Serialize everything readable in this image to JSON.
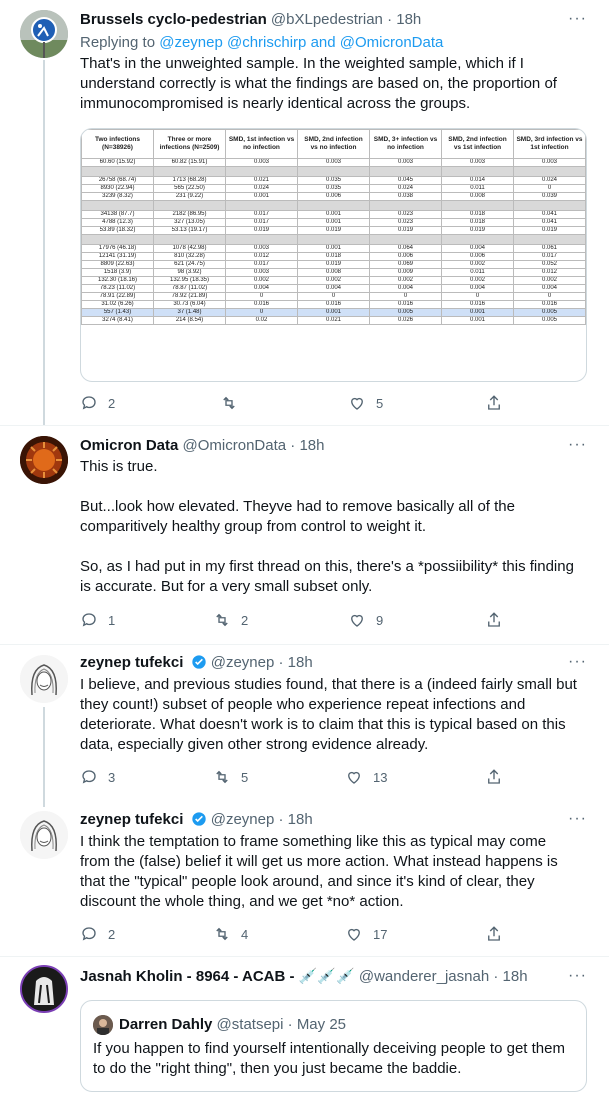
{
  "tweets": [
    {
      "name": "Brussels cyclo-pedestrian",
      "handle": "@bXLpedestrian",
      "time": "18h",
      "replying_prefix": "Replying to",
      "replying_handles": "@zeynep @chrischirp",
      "replying_and": "and",
      "replying_last": "@OmicronData",
      "text": [
        "That's in the unweighted sample. In the weighted sample, which if I understand correctly is what the findings are based on, the proportion of immunocompromised is nearly identical across the groups."
      ],
      "replies": "2",
      "retweets": "",
      "likes": "5"
    },
    {
      "name": "Omicron Data",
      "handle": "@OmicronData",
      "time": "18h",
      "text": [
        "This is true.",
        "But...look how elevated. Theyve had to remove basically all of the comparitively healthy group from control to weight it.",
        "So, as I had put in my first thread on this, there's a *possiibility* this finding is accurate. But for a very small subset only."
      ],
      "replies": "1",
      "retweets": "2",
      "likes": "9"
    },
    {
      "name": "zeynep tufekci",
      "handle": "@zeynep",
      "time": "18h",
      "text": [
        "I believe, and previous studies found, that there is a (indeed fairly small but they count!) subset of people who experience repeat infections and deteriorate. What doesn't work is to claim that this is typical based on this data, especially given other strong evidence already."
      ],
      "replies": "3",
      "retweets": "5",
      "likes": "13"
    },
    {
      "name": "zeynep tufekci",
      "handle": "@zeynep",
      "time": "18h",
      "text": [
        "I think the temptation to frame something like this as  typical may come from the (false) belief it will get us more action. What instead happens is that the \"typical\" people look around, and since it's kind of clear, they discount the whole thing, and we get *no* action."
      ],
      "replies": "2",
      "retweets": "4",
      "likes": "17"
    },
    {
      "name": "Jasnah Kholin - 8964 - ACAB - 💉💉💉",
      "handle": "@wanderer_jasnah",
      "time": "18h"
    }
  ],
  "quote": {
    "name": "Darren Dahly",
    "handle": "@statsepi",
    "time": "May 25",
    "text": "If you happen to find yourself intentionally deceiving people to get them to do the \"right thing\", then you just became the baddie."
  },
  "dot": "·",
  "more": "···",
  "table": {
    "headers": [
      "Two infections (N=38926)",
      "Three or more infections (N=2509)",
      "SMD, 1st infection vs no infection",
      "SMD, 2nd infection vs no infection",
      "SMD, 3+ infection vs no infection",
      "SMD, 2nd infection vs 1st infection",
      "SMD, 3rd infection vs 1st infection"
    ],
    "rows": [
      {
        "cls": "",
        "cells": [
          "60.60 (15.92)",
          "60.82 (15.91)",
          "0.003",
          "0.003",
          "0.003",
          "0.003",
          "0.003"
        ]
      },
      {
        "cls": "gray",
        "cells": [
          "",
          "",
          "",
          "",
          "",
          "",
          ""
        ]
      },
      {
        "cls": "",
        "cells": [
          "26758 (68.74)",
          "1713 (68.28)",
          "0.021",
          "0.035",
          "0.045",
          "0.014",
          "0.024"
        ]
      },
      {
        "cls": "",
        "cells": [
          "8930 (22.94)",
          "565 (22.50)",
          "0.024",
          "0.035",
          "0.024",
          "0.011",
          "0"
        ]
      },
      {
        "cls": "",
        "cells": [
          "3239 (8.32)",
          "231 (9.22)",
          "0.001",
          "0.006",
          "0.038",
          "0.008",
          "0.039"
        ]
      },
      {
        "cls": "gray",
        "cells": [
          "",
          "",
          "",
          "",
          "",
          "",
          ""
        ]
      },
      {
        "cls": "",
        "cells": [
          "34138 (87.7)",
          "2182 (86.95)",
          "0.017",
          "0.001",
          "0.023",
          "0.018",
          "0.041"
        ]
      },
      {
        "cls": "",
        "cells": [
          "4788 (12.3)",
          "327 (13.05)",
          "0.017",
          "0.001",
          "0.023",
          "0.018",
          "0.041"
        ]
      },
      {
        "cls": "",
        "cells": [
          "53.89 (18.32)",
          "53.13 (19.17)",
          "0.019",
          "0.019",
          "0.019",
          "0.019",
          "0.019"
        ]
      },
      {
        "cls": "gray",
        "cells": [
          "",
          "",
          "",
          "",
          "",
          "",
          ""
        ]
      },
      {
        "cls": "",
        "cells": [
          "17976 (46.18)",
          "1078 (42.98)",
          "0.003",
          "0.001",
          "0.064",
          "0.004",
          "0.061"
        ]
      },
      {
        "cls": "",
        "cells": [
          "12141 (31.19)",
          "810 (32.28)",
          "0.012",
          "0.018",
          "0.006",
          "0.006",
          "0.017"
        ]
      },
      {
        "cls": "",
        "cells": [
          "8809 (22.63)",
          "621 (24.75)",
          "0.017",
          "0.019",
          "0.069",
          "0.002",
          "0.052"
        ]
      },
      {
        "cls": "",
        "cells": [
          "1518 (3.9)",
          "98 (3.92)",
          "0.003",
          "0.008",
          "0.009",
          "0.011",
          "0.012"
        ]
      },
      {
        "cls": "",
        "cells": [
          "132.30 (18.16)",
          "132.95 (18.35)",
          "0.002",
          "0.002",
          "0.002",
          "0.002",
          "0.002"
        ]
      },
      {
        "cls": "",
        "cells": [
          "78.23 (11.02)",
          "78.87 (11.02)",
          "0.004",
          "0.004",
          "0.004",
          "0.004",
          "0.004"
        ]
      },
      {
        "cls": "",
        "cells": [
          "78.91 (22.89)",
          "78.92 (21.89)",
          "0",
          "0",
          "0",
          "0",
          "0"
        ]
      },
      {
        "cls": "",
        "cells": [
          "31.02 (6.26)",
          "30.73 (6.04)",
          "0.016",
          "0.016",
          "0.016",
          "0.016",
          "0.016"
        ]
      },
      {
        "cls": "hl",
        "cells": [
          "557 (1.43)",
          "37 (1.48)",
          "0",
          "0.001",
          "0.005",
          "0.001",
          "0.005"
        ]
      },
      {
        "cls": "",
        "cells": [
          "3274 (8.41)",
          "214 (8.54)",
          "0.02",
          "0.021",
          "0.026",
          "0.001",
          "0.005"
        ]
      }
    ]
  }
}
